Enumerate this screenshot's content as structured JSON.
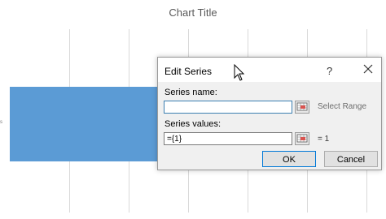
{
  "chart": {
    "title": "Chart Title",
    "axis_tick": "s"
  },
  "dialog": {
    "title": "Edit Series",
    "help_label": "?",
    "series_name_label": "Series name:",
    "series_name_value": "",
    "select_range_label": "Select Range",
    "series_values_label": "Series values:",
    "series_values_value": "={1}",
    "series_values_result": "= 1",
    "ok_label": "OK",
    "cancel_label": "Cancel"
  },
  "colors": {
    "bar": "#5b9bd5",
    "ok_border": "#0078d7"
  },
  "icons": [
    "close-icon",
    "range-selector-icon",
    "mouse-cursor-icon"
  ]
}
